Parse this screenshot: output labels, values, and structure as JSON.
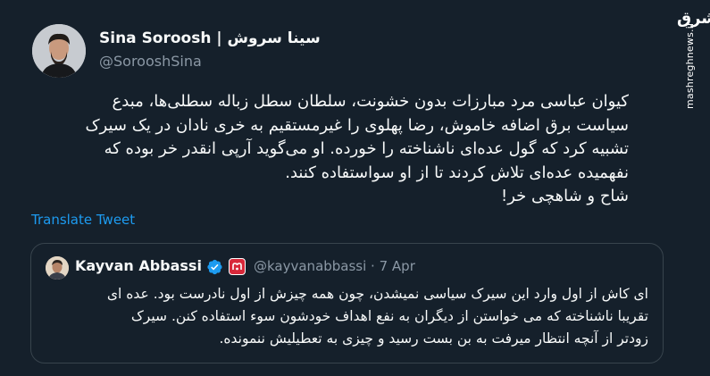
{
  "author": {
    "display_name": "Sina Soroosh | سینا سروش",
    "handle": "@SorooshSina"
  },
  "tweet": {
    "lines": [
      "کیوان عباسی مرد مبارزات بدون خشونت، سلطان سطل زباله سطلی‌ها، مبدع",
      "سیاست برق اضافه خاموش، رضا پهلوی را غیرمستقیم به خری نادان در یک سیرک",
      "تشبیه کرد که گول عده‌ای ناشناخته را خورده. او می‌گوید آرپی انقدر خر بوده که",
      "نفهمیده عده‌ای تلاش کردند تا از او سواستفاده کنند.",
      "شاح و شاهچی خر!"
    ],
    "translate_label": "Translate Tweet"
  },
  "quoted": {
    "name": "Kayvan Abbassi",
    "meta": "@kayvanabbassi · 7 Apr",
    "lines": [
      "ای کاش از اول وارد این سیرک سیاسی نمیشدن، چون همه چیزش از اول نادرست بود. عده ای",
      "تقریبا ناشناخته که می خواستن از دیگران به نفع اهداف خودشون سوء استفاده کنن. سیرک",
      "زودتر از آنچه انتظار میرفت به بن بست رسید و چیزی به تعطیلیش ننمونده."
    ]
  },
  "watermark": {
    "logo_text": "مشرق",
    "url_text": "mashreghnews.ir"
  },
  "colors": {
    "background": "#15202b",
    "text": "#f7f9f9",
    "secondary": "#8b98a5",
    "link": "#1d9bf0",
    "border": "#38444d",
    "verified": "#1d9bf0",
    "affiliation": "#d8283a"
  },
  "icons": {
    "verified": "verified-badge-icon",
    "affiliation": "affiliation-badge-icon"
  }
}
